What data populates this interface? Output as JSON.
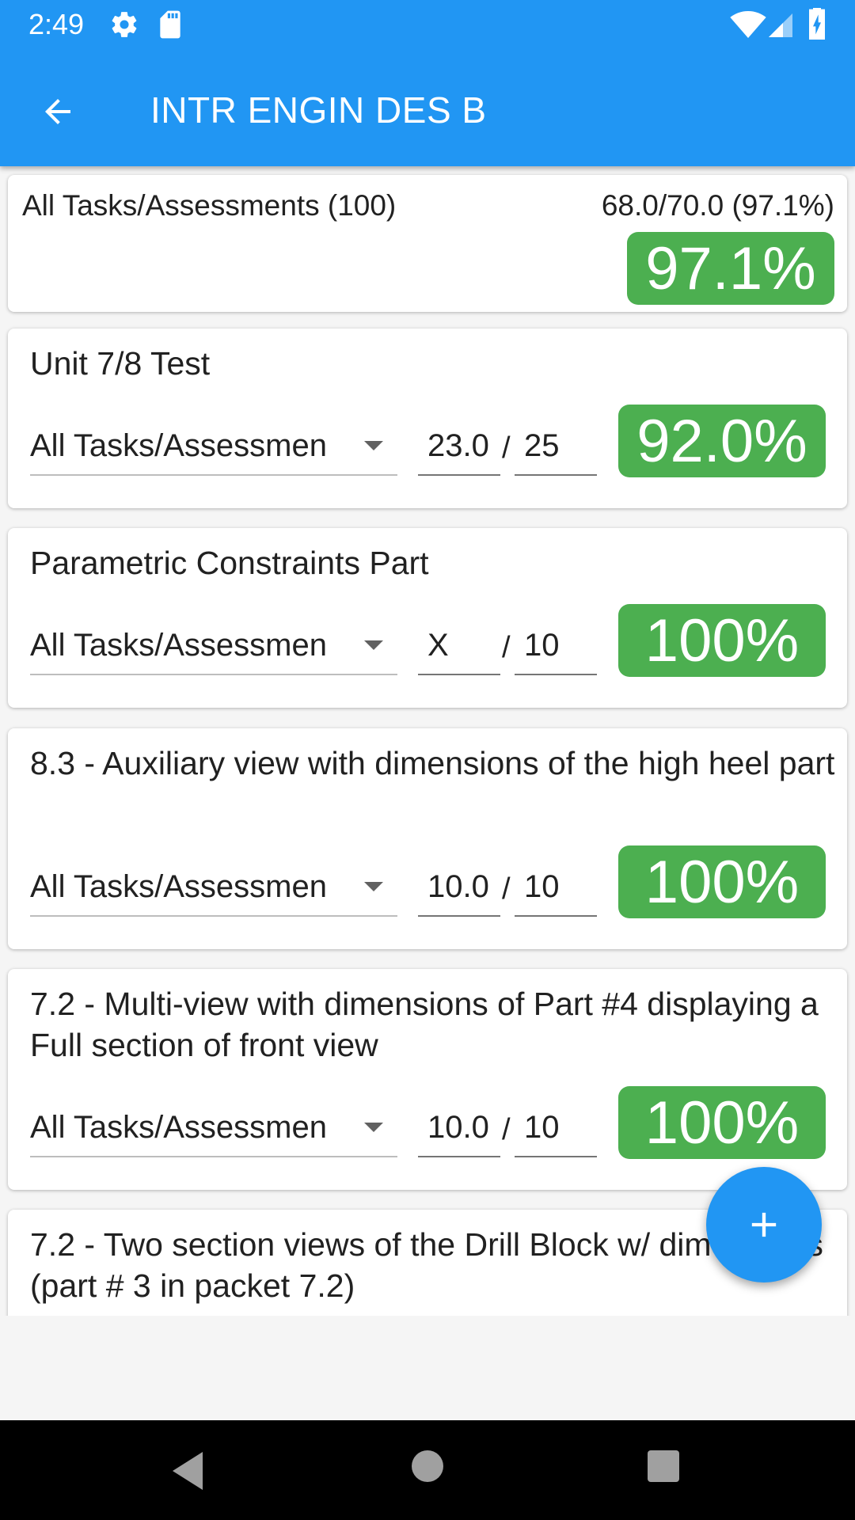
{
  "status_bar": {
    "time": "2:49",
    "icons": [
      "gear-icon",
      "sd-card-icon",
      "wifi-icon",
      "cell-signal-icon",
      "battery-charging-icon"
    ]
  },
  "app_bar": {
    "title": "INTR ENGIN DES B",
    "back_icon": "arrow-back-icon",
    "color": "#2196f3"
  },
  "summary": {
    "label": "All Tasks/Assessments (100)",
    "score_text": "68.0/70.0 (97.1%)",
    "percent": "97.1%"
  },
  "assignments": [
    {
      "title": "Unit 7/8 Test",
      "category": "All Tasks/Assessmen",
      "earned": "23.0",
      "slash": "/",
      "possible": "25",
      "percent": "92.0%"
    },
    {
      "title": "Parametric Constraints Part",
      "category": "All Tasks/Assessmen",
      "earned": "X",
      "slash": "/",
      "possible": "10",
      "percent": "100%"
    },
    {
      "title": "8.3 - Auxiliary view with dimensions of the high heel part",
      "category": "All Tasks/Assessmen",
      "earned": "10.0",
      "slash": "/",
      "possible": "10",
      "percent": "100%"
    },
    {
      "title": "7.2 - Multi-view with dimensions of Part #4 displaying a Full section of front view",
      "category": "All Tasks/Assessmen",
      "earned": "10.0",
      "slash": "/",
      "possible": "10",
      "percent": "100%"
    },
    {
      "title": "7.2 - Two section views of the Drill Block w/ dimensions (part # 3 in packet 7.2)"
    }
  ],
  "fab": {
    "icon": "plus-icon"
  },
  "nav_bar": {
    "icons": [
      "nav-back-icon",
      "nav-home-icon",
      "nav-recents-icon"
    ]
  },
  "colors": {
    "primary": "#2196f3",
    "badge_green": "#4caf50",
    "background": "#f5f5f5"
  }
}
